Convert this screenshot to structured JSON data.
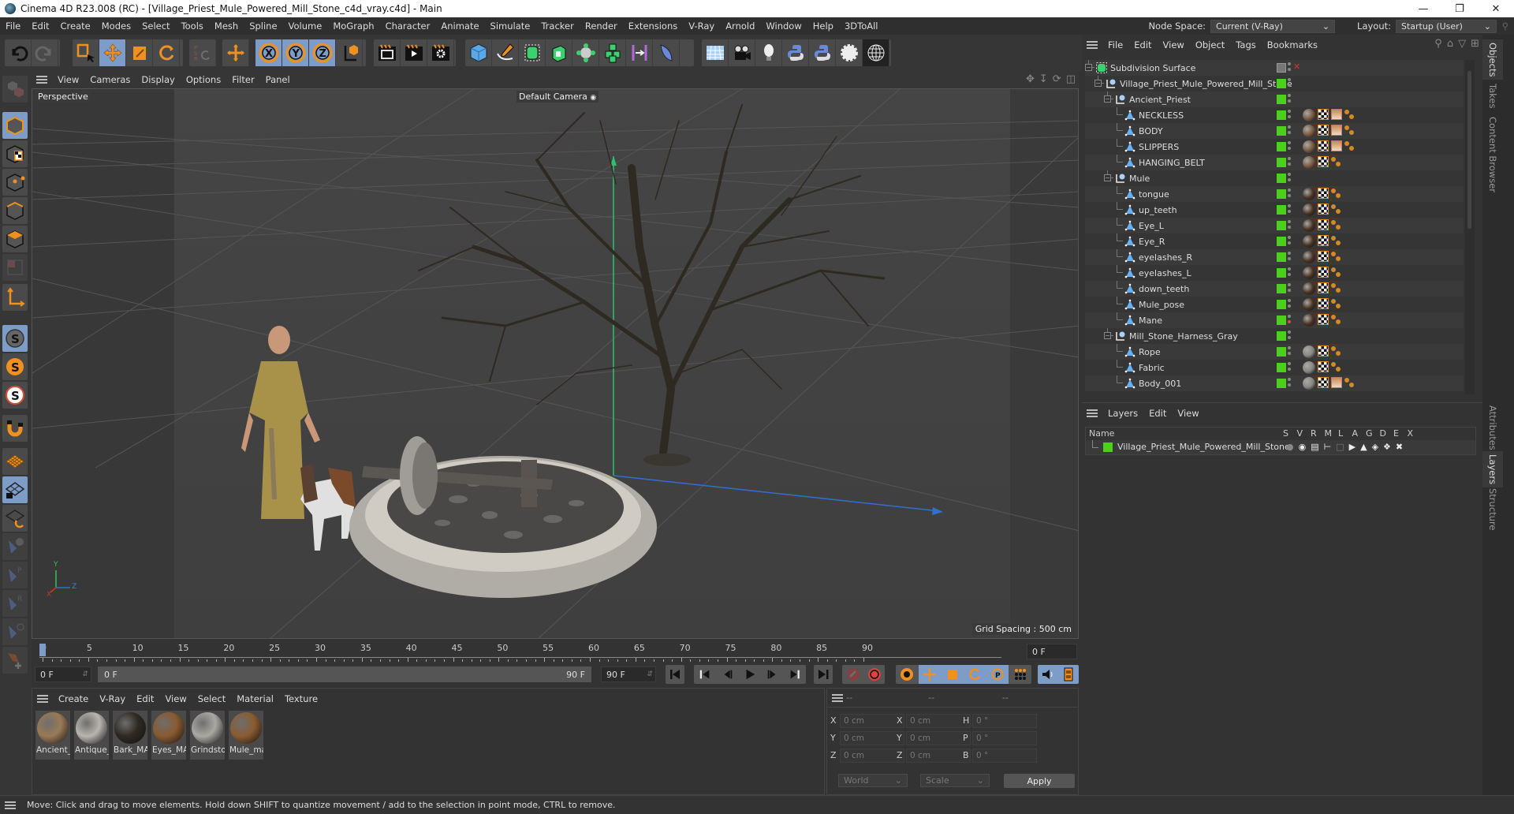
{
  "window": {
    "title": "Cinema 4D R23.008 (RC) - [Village_Priest_Mule_Powered_Mill_Stone_c4d_vray.c4d] - Main",
    "controls": [
      "minimize",
      "maximize",
      "close"
    ]
  },
  "menubar": {
    "items": [
      "File",
      "Edit",
      "Create",
      "Modes",
      "Select",
      "Tools",
      "Mesh",
      "Spline",
      "Volume",
      "MoGraph",
      "Character",
      "Animate",
      "Simulate",
      "Tracker",
      "Render",
      "Extensions",
      "V-Ray",
      "Arnold",
      "Window",
      "Help",
      "3DToAll"
    ],
    "node_space_label": "Node Space:",
    "node_space_value": "Current (V-Ray)",
    "layout_label": "Layout:",
    "layout_value": "Startup (User)"
  },
  "toolbar": {
    "groups": [
      [
        "undo-icon",
        "redo-icon"
      ],
      [
        "live-selection-icon",
        "move-icon",
        "scale-icon",
        "rotate-icon"
      ],
      [
        "psr-icon"
      ],
      [
        "world-axis-icon"
      ],
      [
        "x-axis-lock-icon",
        "y-axis-lock-icon",
        "z-axis-lock-icon",
        "coordinate-system-icon"
      ],
      [
        "render-view-icon",
        "render-picture-viewer-icon",
        "render-settings-icon"
      ],
      [
        "cube-icon",
        "pen-icon",
        "subdivision-icon",
        "extrude-icon",
        "cloner-icon",
        "mograph-icon",
        "symmetry-icon",
        "deformer-icon"
      ],
      [
        "floor-icon",
        "camera-icon",
        "light-icon",
        "python-icon",
        "python-generator-icon",
        "settings-gear-icon",
        "globe-icon"
      ]
    ]
  },
  "viewport": {
    "menu": [
      "View",
      "Cameras",
      "Display",
      "Options",
      "Filter",
      "Panel"
    ],
    "projection": "Perspective",
    "camera": "Default Camera",
    "grid_spacing": "Grid Spacing : 500 cm",
    "axis_labels": {
      "x": "X",
      "y": "Y",
      "z": "Z"
    }
  },
  "timeline": {
    "ticks": [
      "0",
      "5",
      "10",
      "15",
      "20",
      "25",
      "30",
      "35",
      "40",
      "45",
      "50",
      "55",
      "60",
      "65",
      "70",
      "75",
      "80",
      "85",
      "90"
    ],
    "current_frame": "0 F",
    "start_frame": "0 F",
    "range_start": "0 F",
    "range_end": "90 F",
    "end_frame": "90 F",
    "current_frame_right": "0 F",
    "max_frame": 90,
    "playhead_frame": 0
  },
  "materials": {
    "menu": [
      "Create",
      "V-Ray",
      "Edit",
      "View",
      "Select",
      "Material",
      "Texture"
    ],
    "items": [
      {
        "label": "Ancient_",
        "color": "#9a7a55"
      },
      {
        "label": "Antique_",
        "color": "#b8b4ae"
      },
      {
        "label": "Bark_MA",
        "color": "#2e2a22"
      },
      {
        "label": "Eyes_MA",
        "color": "#8a5a30"
      },
      {
        "label": "Grindsto",
        "color": "#aaa8a2"
      },
      {
        "label": "Mule_ma",
        "color": "#8a5c32"
      }
    ]
  },
  "coordinates": {
    "headers": [
      "--",
      "--",
      "--"
    ],
    "rows": [
      {
        "l1": "X",
        "v1": "0 cm",
        "l2": "X",
        "v2": "0 cm",
        "l3": "H",
        "v3": "0 °"
      },
      {
        "l1": "Y",
        "v1": "0 cm",
        "l2": "Y",
        "v2": "0 cm",
        "l3": "P",
        "v3": "0 °"
      },
      {
        "l1": "Z",
        "v1": "0 cm",
        "l2": "Z",
        "v2": "0 cm",
        "l3": "B",
        "v3": "0 °"
      }
    ],
    "space_value": "World",
    "mode_value": "Scale",
    "apply_label": "Apply"
  },
  "objects_panel": {
    "menu": [
      "File",
      "Edit",
      "View",
      "Object",
      "Tags",
      "Bookmarks"
    ],
    "rows": [
      {
        "name": "Subdivision Surface",
        "depth": 0,
        "type": "subdivision",
        "tags": "none",
        "enabled": "check"
      },
      {
        "name": "Village_Priest_Mule_Powered_Mill_Stone",
        "depth": 1,
        "type": "null",
        "tags": "none"
      },
      {
        "name": "Ancient_Priest",
        "depth": 2,
        "type": "null",
        "tags": "none"
      },
      {
        "name": "NECKLESS",
        "depth": 3,
        "type": "poly",
        "tags": "mat-uvw-sel-phong",
        "mat": "#7a5a40"
      },
      {
        "name": "BODY",
        "depth": 3,
        "type": "poly",
        "tags": "mat-uvw-sel-phong",
        "mat": "#7a5a40"
      },
      {
        "name": "SLIPPERS",
        "depth": 3,
        "type": "poly",
        "tags": "mat-uvw-sel-phong",
        "mat": "#7a5a40"
      },
      {
        "name": "HANGING_BELT",
        "depth": 3,
        "type": "poly",
        "tags": "mat-uvw-phong",
        "mat": "#7a5a40"
      },
      {
        "name": "Mule",
        "depth": 2,
        "type": "null",
        "tags": "none"
      },
      {
        "name": "tongue",
        "depth": 3,
        "type": "poly",
        "tags": "mat-uvw-phong",
        "mat": "#4a3322"
      },
      {
        "name": "up_teeth",
        "depth": 3,
        "type": "poly",
        "tags": "mat-uvw-phong",
        "mat": "#4a3322"
      },
      {
        "name": "Eye_L",
        "depth": 3,
        "type": "poly",
        "tags": "mat-uvw-phong",
        "mat": "#4a3322"
      },
      {
        "name": "Eye_R",
        "depth": 3,
        "type": "poly",
        "tags": "mat-uvw-phong",
        "mat": "#4a3322"
      },
      {
        "name": "eyelashes_R",
        "depth": 3,
        "type": "poly",
        "tags": "mat-uvw-phong",
        "mat": "#4a3322"
      },
      {
        "name": "eyelashes_L",
        "depth": 3,
        "type": "poly",
        "tags": "mat-uvw-phong",
        "mat": "#4a3322"
      },
      {
        "name": "down_teeth",
        "depth": 3,
        "type": "poly",
        "tags": "mat-uvw-phong",
        "mat": "#4a3322"
      },
      {
        "name": "Mule_pose",
        "depth": 3,
        "type": "poly",
        "tags": "mat-uvw-phong",
        "mat": "#4a3322"
      },
      {
        "name": "Mane",
        "depth": 3,
        "type": "poly",
        "tags": "mat-uvw-phong",
        "mat": "#4a3322",
        "render_dot": "red"
      },
      {
        "name": "Mill_Stone_Harness_Gray",
        "depth": 2,
        "type": "null",
        "tags": "none"
      },
      {
        "name": "Rope",
        "depth": 3,
        "type": "poly",
        "tags": "mat-uvw-phong",
        "mat": "#888680"
      },
      {
        "name": "Fabric",
        "depth": 3,
        "type": "poly",
        "tags": "mat-uvw-phong",
        "mat": "#888680"
      },
      {
        "name": "Body_001",
        "depth": 3,
        "type": "poly",
        "tags": "mat-uvw-sel-phong",
        "mat": "#888680"
      }
    ]
  },
  "layers_panel": {
    "menu": [
      "Layers",
      "Edit",
      "View"
    ],
    "columns": [
      "Name",
      "S",
      "V",
      "R",
      "M",
      "L",
      "A",
      "G",
      "D",
      "E",
      "X"
    ],
    "rows": [
      {
        "name": "Village_Priest_Mule_Powered_Mill_Stone",
        "color": "#4bd11c"
      }
    ]
  },
  "side_tabs": {
    "top": [
      "Objects",
      "Takes",
      "Content Browser"
    ],
    "bottom": [
      "Attributes",
      "Layers",
      "Structure"
    ],
    "active_top": "Objects",
    "active_bottom": "Layers"
  },
  "status": {
    "text": "Move: Click and drag to move elements. Hold down SHIFT to quantize movement / add to the selection in point mode, CTRL to remove."
  },
  "colors": {
    "accent_selected": "#7d9cc8",
    "orange": "#f0901e",
    "enabled_green": "#4bd11c",
    "axis_x": "#d03030",
    "axis_y": "#30c060",
    "axis_z": "#3070d0"
  }
}
